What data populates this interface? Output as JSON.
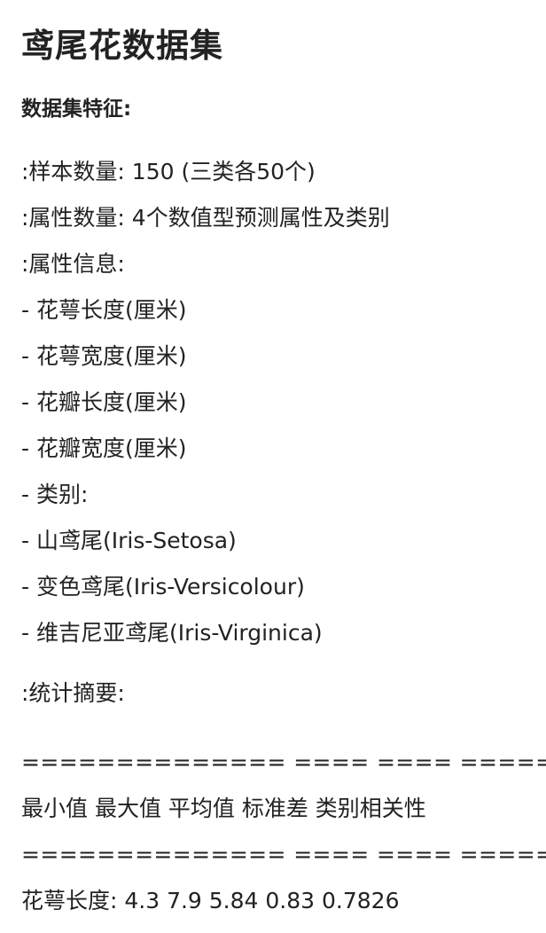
{
  "document": {
    "title": "鸢尾花数据集",
    "section_heading": "数据集特征:",
    "characteristics": [
      ":样本数量: 150 (三类各50个)",
      ":属性数量: 4个数值型预测属性及类别",
      ":属性信息:",
      "- 花萼长度(厘米)",
      "- 花萼宽度(厘米)",
      "- 花瓣长度(厘米)",
      "- 花瓣宽度(厘米)",
      "- 类别:",
      "- 山鸢尾(Iris-Setosa)",
      "- 变色鸢尾(Iris-Versicolour)",
      "- 维吉尼亚鸢尾(Iris-Virginica)"
    ],
    "summary_label": ":统计摘要:",
    "summary": {
      "rule_top": "============== ==== ==== ======= ===== ====================",
      "header": "最小值 最大值 平均值 标准差 类别相关性",
      "rule_mid": "============== ==== ==== ======= ===== ====================",
      "first_row": "花萼长度: 4.3 7.9 5.84 0.83 0.7826"
    }
  }
}
